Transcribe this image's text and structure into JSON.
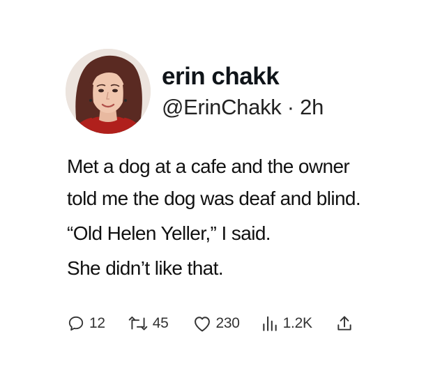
{
  "author": {
    "name": "erin chakk",
    "handle": "@ErinChakk",
    "separator": "·",
    "time": "2h"
  },
  "body": {
    "lines": [
      "Met a dog at a cafe and the owner",
      "told me the dog was deaf and blind.",
      "“Old Helen Yeller,” I said.",
      "She didn’t like that."
    ]
  },
  "actions": {
    "replies": {
      "icon": "comment-icon",
      "count": "12"
    },
    "retweets": {
      "icon": "retweet-icon",
      "count": "45"
    },
    "likes": {
      "icon": "heart-icon",
      "count": "230"
    },
    "views": {
      "icon": "bar-chart-icon",
      "count": "1.2K"
    },
    "share": {
      "icon": "share-icon"
    }
  },
  "colors": {
    "text": "#0f1419",
    "icon": "#333333",
    "background": "#ffffff"
  }
}
